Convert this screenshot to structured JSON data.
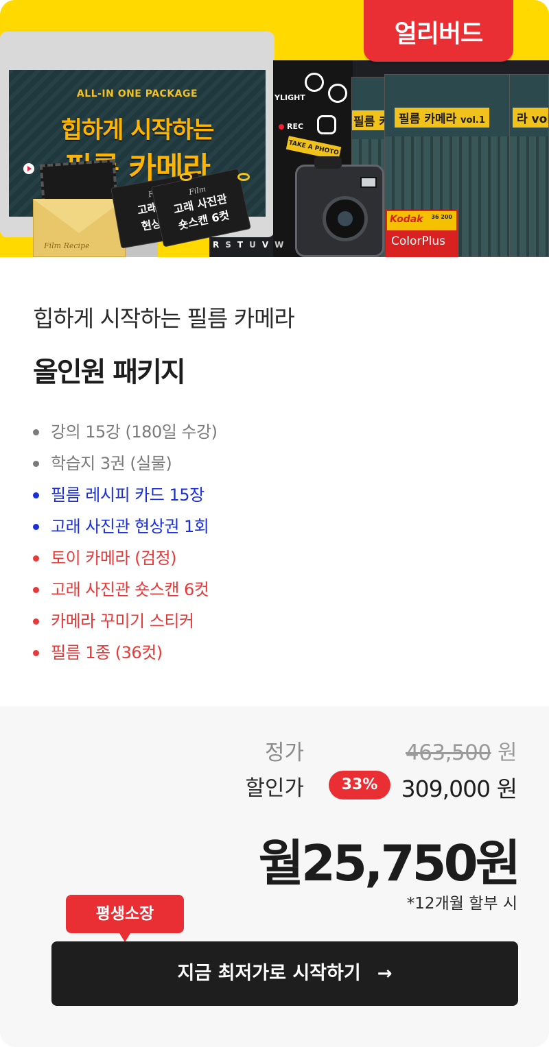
{
  "badge": {
    "label": "얼리버드"
  },
  "hero": {
    "package_label": "ALL-IN ONE PACKAGE",
    "title_line1": "힙하게 시작하는",
    "title_line2": "필름 카메라",
    "envelope_text": "Film Recipe",
    "ticket_script": "Film",
    "ticket1_line1": "고래 사진",
    "ticket1_line2": "현상권 1",
    "ticket2_line1": "고래 사진관",
    "ticket2_line2": "숏스캔 6컷",
    "sticker_light": "YLIGHT",
    "sticker_rec": "REC",
    "sticker_take": "TAKE A PHOTO",
    "letters": [
      "R",
      "S",
      "T",
      "U",
      "V",
      "W"
    ],
    "kodak_brand": "Kodak",
    "kodak_count": "36 200",
    "kodak_product": "ColorPlus",
    "poster_edge_left": "필름 카",
    "poster_title": "필름 카메라",
    "poster_vol": "vol.1",
    "poster_edge_right": "라 vol"
  },
  "product": {
    "subtitle": "힙하게 시작하는 필름 카메라",
    "title": "올인원 패키지",
    "features": [
      {
        "text": "강의 15강 (180일 수강)",
        "color": "#7a7a7a"
      },
      {
        "text": "학습지 3권 (실물)",
        "color": "#7a7a7a"
      },
      {
        "text": "필름 레시피 카드 15장",
        "color": "#1a2fd6"
      },
      {
        "text": "고래 사진관 현상권 1회",
        "color": "#1a2fd6"
      },
      {
        "text": "토이 카메라 (검정)",
        "color": "#e63a3a"
      },
      {
        "text": "고래 사진관 숏스캔 6컷",
        "color": "#e63a3a"
      },
      {
        "text": "카메라 꾸미기 스티커",
        "color": "#e63a3a"
      },
      {
        "text": "필름 1종 (36컷)",
        "color": "#e63a3a"
      }
    ]
  },
  "pricing": {
    "regular_label": "정가",
    "regular_price": "463,500",
    "currency": "원",
    "sale_label": "할인가",
    "discount": "33%",
    "sale_price": "309,000",
    "monthly": "월25,750원",
    "installment_note": "*12개월 할부 시"
  },
  "cta": {
    "badge": "평생소장",
    "label": "지금 최저가로 시작하기",
    "arrow": "→"
  },
  "colors": {
    "accent_red": "#ea2f34",
    "hero_yellow": "#ffd900",
    "feature_gray": "#7a7a7a",
    "feature_blue": "#1a2fd6",
    "feature_red": "#e63a3a"
  }
}
